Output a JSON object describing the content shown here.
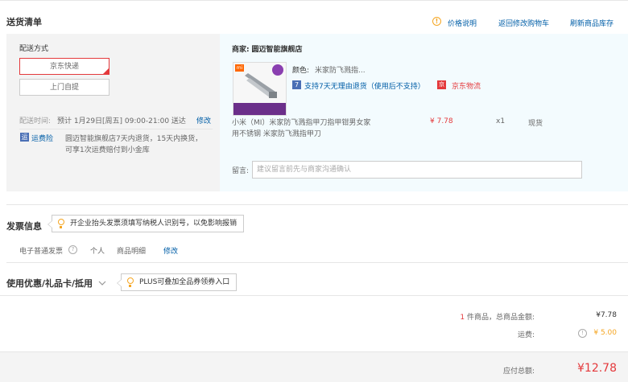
{
  "header": {
    "title": "送货清单",
    "price_note": "价格说明",
    "back_to_cart": "返回修改购物车",
    "refresh_stock": "刷新商品库存"
  },
  "shipping": {
    "label": "配送方式",
    "options": [
      "京东快递",
      "上门自提"
    ],
    "selected": "京东快递",
    "time_label": "配送时间:",
    "time_value": "预计 1月29日[周五] 09:00-21:00 送达",
    "modify": "修改",
    "insurance_badge": "运",
    "insurance_label": "运费险",
    "insurance_desc_line1": "圆迈智能旗舰店7天内退货，15天内换货，",
    "insurance_desc_line2": "可享1次运费赔付到小金库"
  },
  "store": {
    "label": "商家:",
    "name": "圆迈智能旗舰店"
  },
  "product": {
    "thumb_brand": "mi",
    "color_label": "颜色:",
    "color_value": "米家防飞溅指...",
    "return_badge": "7",
    "return_policy": "支持7天无理由退货（使用后不支持）",
    "jd_badge": "京",
    "logistics": "京东物流",
    "name_line1": "小米（MI）米家防飞溅指甲刀指甲钳男女家",
    "name_line2": "用不锈钢 米家防飞溅指甲刀",
    "price": "¥ 7.78",
    "quantity": "x1",
    "stock": "现货"
  },
  "remark": {
    "label": "留言:",
    "placeholder": "建议留言前先与商家沟通确认"
  },
  "invoice": {
    "title": "发票信息",
    "tip": "开企业抬头发票须填写纳税人识别号，以免影响报销",
    "type": "电子普通发票",
    "holder": "个人",
    "content": "商品明细",
    "modify": "修改"
  },
  "coupon": {
    "title": "使用优惠/礼品卡/抵用",
    "tip": "PLUS可叠加全品券领券入口"
  },
  "summary": {
    "item_count": "1",
    "item_label": "件商品，总商品金额:",
    "item_total": "¥7.78",
    "freight_label": "运费:",
    "freight_value": "¥ 5.00",
    "total_label": "应付总额:",
    "total_value": "¥12.78"
  },
  "colors": {
    "accent_red": "#e4393c",
    "link_blue": "#005ea7",
    "warning_orange": "#f5a623"
  }
}
